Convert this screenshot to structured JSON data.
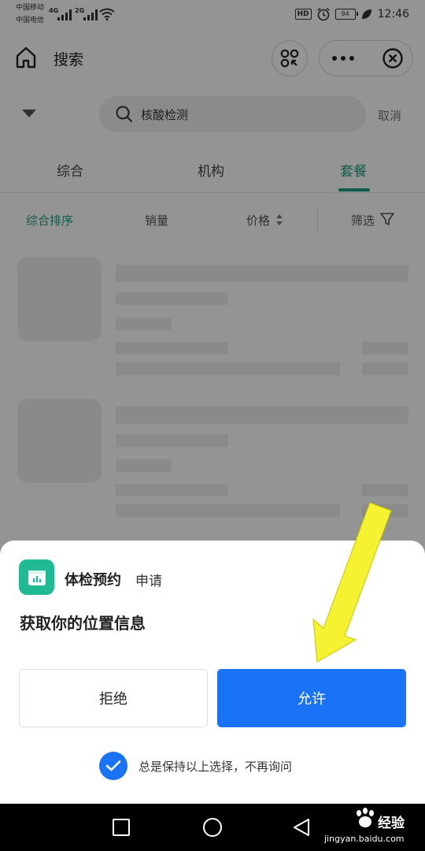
{
  "status_bar": {
    "carrier_1": "中国移动",
    "carrier_2": "中国电信",
    "net_1": "4G",
    "net_2": "2G",
    "hd": "HD",
    "battery": "94",
    "time": "12:46"
  },
  "nav": {
    "title": "搜索"
  },
  "search": {
    "query": "核酸检测",
    "cancel_label": "取消"
  },
  "tabs": [
    {
      "label": "综合",
      "active": false
    },
    {
      "label": "机构",
      "active": false
    },
    {
      "label": "套餐",
      "active": true
    }
  ],
  "sort_bar": {
    "items": [
      "综合排序",
      "销量",
      "价格",
      "筛选"
    ],
    "active_index": 0
  },
  "permission_sheet": {
    "app_name": "体检预约",
    "request_label": "申请",
    "title": "获取你的位置信息",
    "deny_label": "拒绝",
    "allow_label": "允许",
    "remember_label": "总是保持以上选择，不再询问",
    "remember_checked": true
  },
  "watermark": {
    "brand": "经验",
    "url": "jingyan.baidu.com"
  },
  "colors": {
    "accent_green": "#1a9e86",
    "primary_blue": "#1a73f5",
    "app_icon": "#1fba93",
    "annotation_arrow": "#f5f232"
  },
  "icons": {
    "home": "home-icon",
    "scan": "scan-code-icon",
    "more": "more-dots-icon",
    "close": "close-circle-icon",
    "search": "search-icon",
    "filter": "funnel-icon"
  }
}
